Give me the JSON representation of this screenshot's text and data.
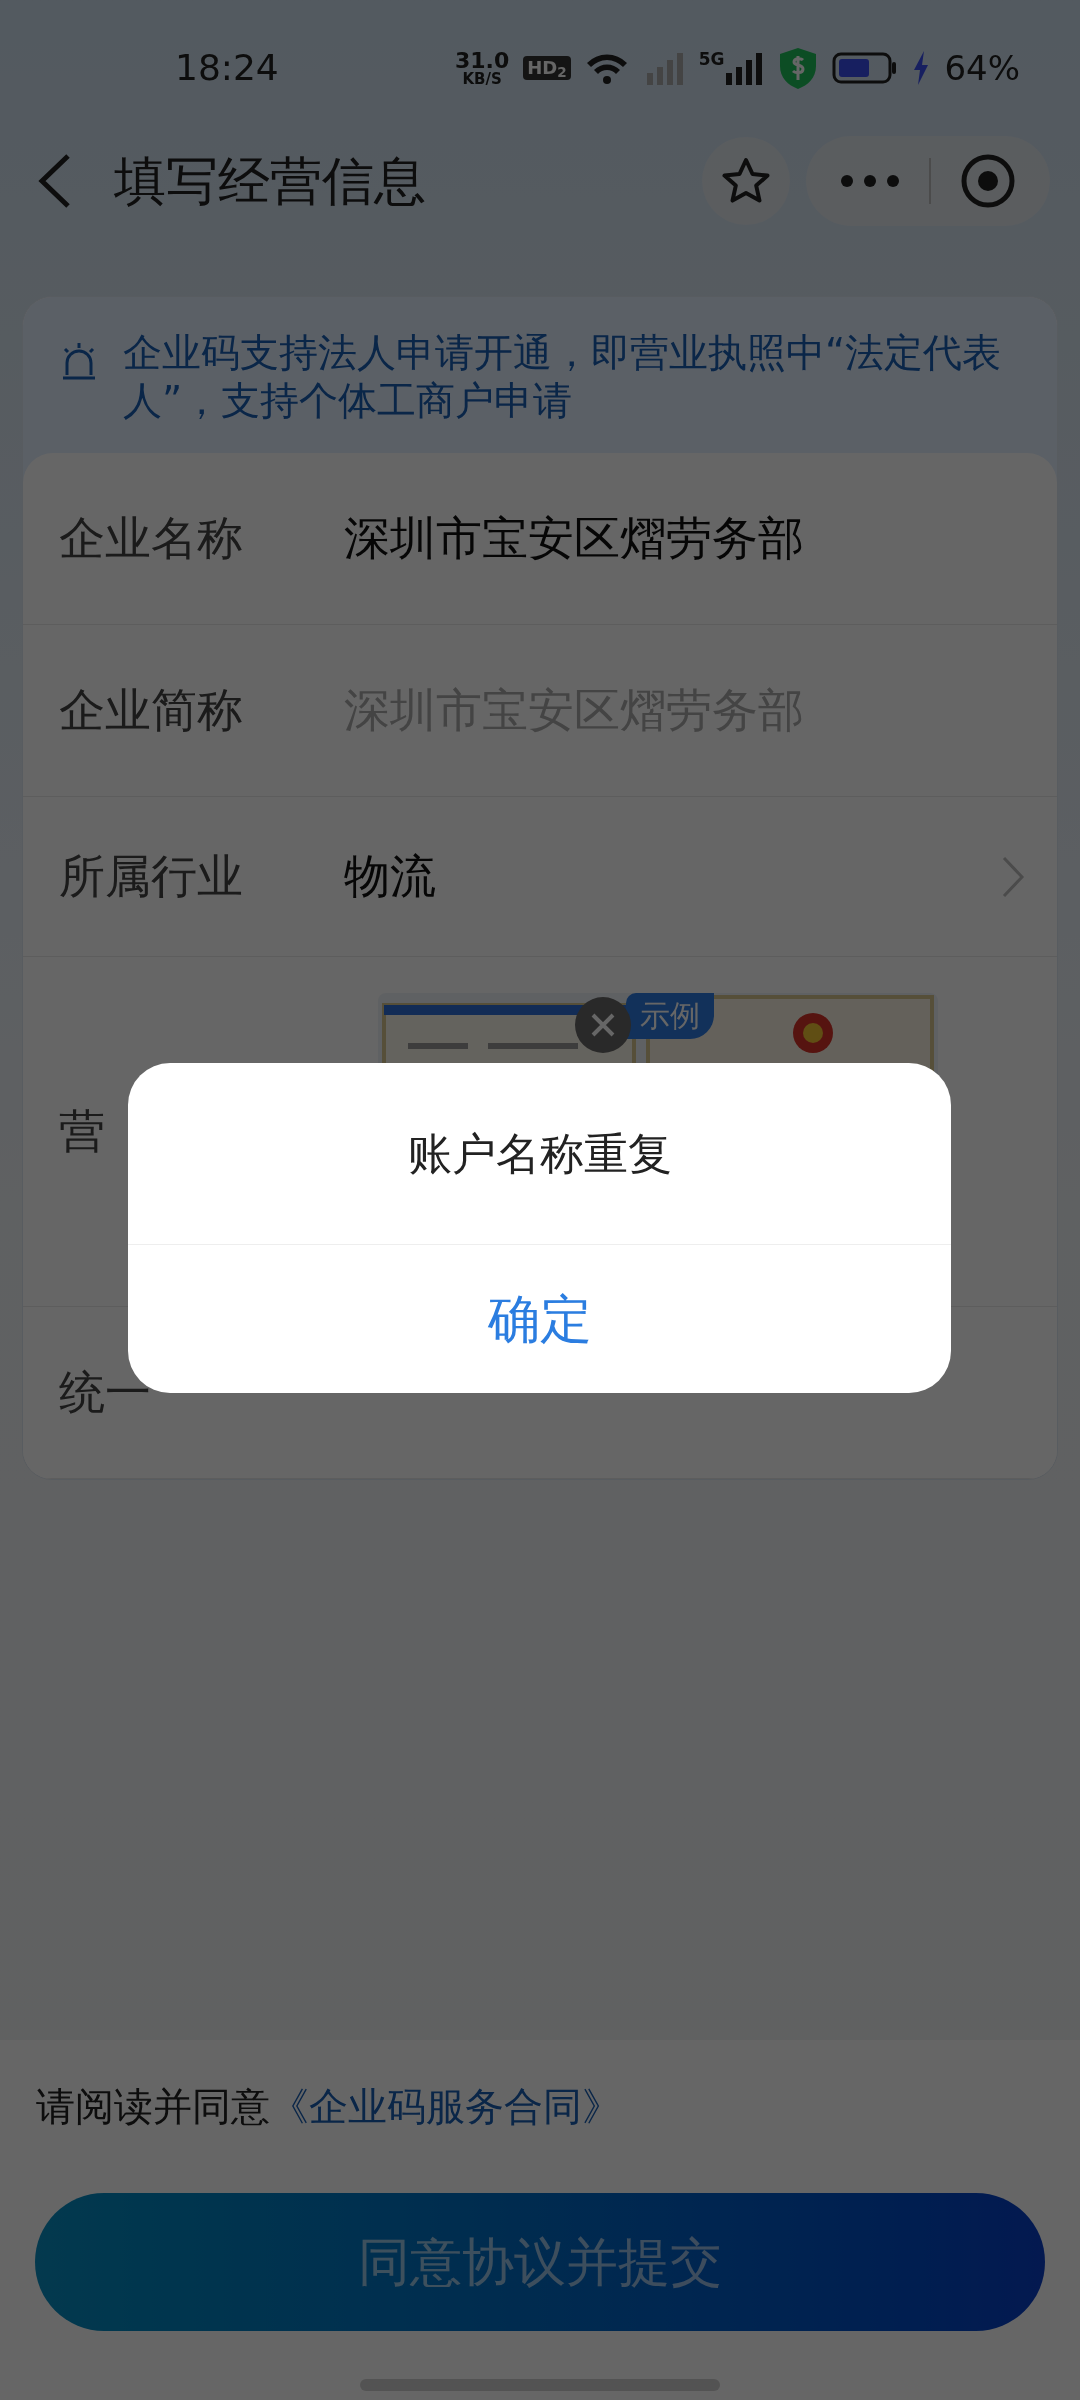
{
  "status_bar": {
    "time": "18:24",
    "net_speed": "31.0",
    "net_unit": "KB/S",
    "hd_badge": "HD$_{2}$",
    "network": "5G",
    "battery": "64%"
  },
  "nav": {
    "title": "填写经营信息"
  },
  "notice": {
    "text": "企业码支持法人申请开通，即营业执照中“法定代表人”，支持个体工商户申请"
  },
  "form": {
    "rows": [
      {
        "kind": "value",
        "label": "企业名称",
        "value": "深圳市宝安区熠劳务部"
      },
      {
        "kind": "input",
        "label": "企业简称",
        "placeholder": "深圳市宝安区熠劳务部"
      },
      {
        "kind": "select",
        "label": "所属行业",
        "value": "物流"
      },
      {
        "kind": "upload",
        "label": "营",
        "badge": "示例"
      },
      {
        "kind": "value",
        "label": "统一"
      }
    ]
  },
  "footer": {
    "agreement_text": "请阅读并同意",
    "agreement_link": "《企业码服务合同》",
    "submit_button": "同意协议并提交"
  },
  "dialog": {
    "message": "账户名称重复",
    "confirm_button": "确定"
  }
}
